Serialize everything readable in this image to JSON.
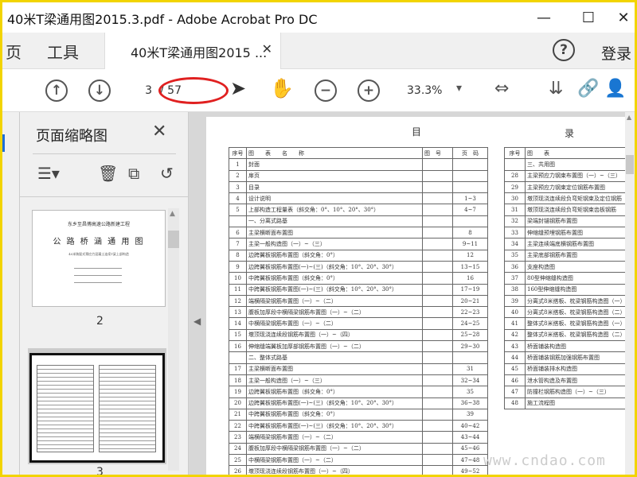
{
  "window": {
    "title": "40米T梁通用图2015.3.pdf - Adobe Acrobat Pro DC",
    "minimize": "—",
    "maximize": "☐",
    "close": "✕"
  },
  "tabbar": {
    "nav_home": "页",
    "nav_tools": "工具",
    "tab_label": "40米T梁通用图2015 ...",
    "tab_close": "✕",
    "help": "?",
    "login": "登录"
  },
  "toolbar": {
    "prev_page": "↑",
    "next_page": "↓",
    "current_page": "3",
    "total_pages": "/ 57",
    "select_tool": "➤",
    "hand_tool": "✋",
    "zoom_out": "−",
    "zoom_in": "+",
    "zoom_level": "33.3%",
    "zoom_dropdown": "▾",
    "fit_icon": "⇔",
    "stamp_icon": "⇊",
    "link_icon": "🔗",
    "share_icon": "👤"
  },
  "sidebar": {
    "title": "页面缩略图",
    "close": "✕",
    "tool_options": "☰▾",
    "tool_delete": "🗑",
    "tool_extract": "⧉",
    "tool_rotate": "↺",
    "thumbnails": [
      {
        "page_number": "2",
        "line1": "东乡至昌傅高速公路新建工程",
        "line2": "公 路 桥 涵 通 用 图",
        "line3": "40米装配式预应力混凝土连续T梁上部构造"
      },
      {
        "page_number": "3"
      }
    ]
  },
  "document": {
    "heading_left": "目",
    "heading_right": "录",
    "columns": [
      "序号",
      "图　　表　　名　　称",
      "图　号",
      "页　码"
    ],
    "rows": [
      [
        "1",
        "封面",
        "",
        ""
      ],
      [
        "2",
        "扉页",
        "",
        ""
      ],
      [
        "3",
        "目录",
        "",
        ""
      ],
      [
        "4",
        "设计说明",
        "",
        "1~3"
      ],
      [
        "5",
        "上部构造工程量表（斜交角：0°、10°、20°、30°）",
        "",
        "4~7"
      ],
      [
        "",
        "一、分离式路基",
        "",
        ""
      ],
      [
        "6",
        "主梁横断面布置图",
        "",
        "8"
      ],
      [
        "7",
        "主梁一般构造图（一）~（三）",
        "",
        "9~11"
      ],
      [
        "8",
        "边跨翼板钢筋布置图（斜交角：0°）",
        "",
        "12"
      ],
      [
        "9",
        "边跨翼板钢筋布置图(一)~(三)（斜交角：10°、20°、30°）",
        "",
        "13~15"
      ],
      [
        "10",
        "中跨翼板钢筋布置图（斜交角：0°）",
        "",
        "16"
      ],
      [
        "11",
        "中跨翼板钢筋布置图(一)~(三)（斜交角：10°、20°、30°）",
        "",
        "17~19"
      ],
      [
        "12",
        "端横隔梁钢筋布置图（一）~（二）",
        "",
        "20~21"
      ],
      [
        "13",
        "腹板加厚段中横隔梁钢筋布置图（一）~（二）",
        "",
        "22~23"
      ],
      [
        "14",
        "中横隔梁钢筋布置图（一）~（二）",
        "",
        "24~25"
      ],
      [
        "15",
        "墩顶现浇连续段钢筋布置图（一）~（四）",
        "",
        "25~28"
      ],
      [
        "16",
        "伸缩缝端翼板加厚部钢筋布置图（一）~（二）",
        "",
        "29~30"
      ],
      [
        "",
        "二、整体式路基",
        "",
        ""
      ],
      [
        "17",
        "主梁横断面布置图",
        "",
        "31"
      ],
      [
        "18",
        "主梁一般构造图（一）~（三）",
        "",
        "32~34"
      ],
      [
        "19",
        "边跨翼板钢筋布置图（斜交角：0°）",
        "",
        "35"
      ],
      [
        "20",
        "边跨翼板钢筋布置图(一)~(三)（斜交角：10°、20°、30°）",
        "",
        "36~38"
      ],
      [
        "21",
        "中跨翼板钢筋布置图（斜交角：0°）",
        "",
        "39"
      ],
      [
        "22",
        "中跨翼板钢筋布置图(一)~(三)（斜交角：10°、20°、30°）",
        "",
        "40~42"
      ],
      [
        "23",
        "端横隔梁钢筋布置图（一）~（二）",
        "",
        "43~44"
      ],
      [
        "24",
        "腹板加厚段中横隔梁钢筋布置图（一）~（二）",
        "",
        "45~46"
      ],
      [
        "25",
        "中横隔梁钢筋布置图（一）~（二）",
        "",
        "47~48"
      ],
      [
        "26",
        "墩顶现浇连续段钢筋布置图（一）~（四）",
        "",
        "49~52"
      ]
    ],
    "right_columns": [
      "序号",
      "图　　表"
    ],
    "right_rows": [
      [
        "",
        "三、共用图"
      ],
      [
        "28",
        "主梁预应力钢束布置图（一）~（三）"
      ],
      [
        "29",
        "主梁预应力钢束定位钢筋布置图"
      ],
      [
        "30",
        "墩顶现浇连续段负弯矩钢束及定位钢筋"
      ],
      [
        "31",
        "墩顶现浇连续段负弯矩钢束齿板钢筋"
      ],
      [
        "32",
        "梁端封锚钢筋布置图"
      ],
      [
        "33",
        "伸缩缝预埋钢筋布置图"
      ],
      [
        "34",
        "主梁连续端底横钢筋布置图"
      ],
      [
        "35",
        "主梁底部钢筋布置图"
      ],
      [
        "36",
        "支座构造图"
      ],
      [
        "37",
        "80型伸缩缝构造图"
      ],
      [
        "38",
        "160型伸缩缝构造图"
      ],
      [
        "39",
        "分离式8米搭板、枕梁钢筋构造图（一）"
      ],
      [
        "40",
        "分离式8米搭板、枕梁钢筋构造图（二）"
      ],
      [
        "41",
        "整体式8米搭板、枕梁钢筋构造图（一）"
      ],
      [
        "42",
        "整体式8米搭板、枕梁钢筋构造图（二）"
      ],
      [
        "43",
        "桥面铺装构造图"
      ],
      [
        "44",
        "桥面铺装钢筋加强钢筋布置图"
      ],
      [
        "45",
        "桥面铺装排水构造图"
      ],
      [
        "46",
        "泄水管构造及布置图"
      ],
      [
        "47",
        "防撞栏钢筋构造图（一）~（三）"
      ],
      [
        "48",
        "施工流程图"
      ]
    ]
  },
  "watermark": "www.cndao.com",
  "colors": {
    "accent": "#1e6fd9",
    "highlight_oval": "#e02020",
    "frame": "#f2d400"
  }
}
